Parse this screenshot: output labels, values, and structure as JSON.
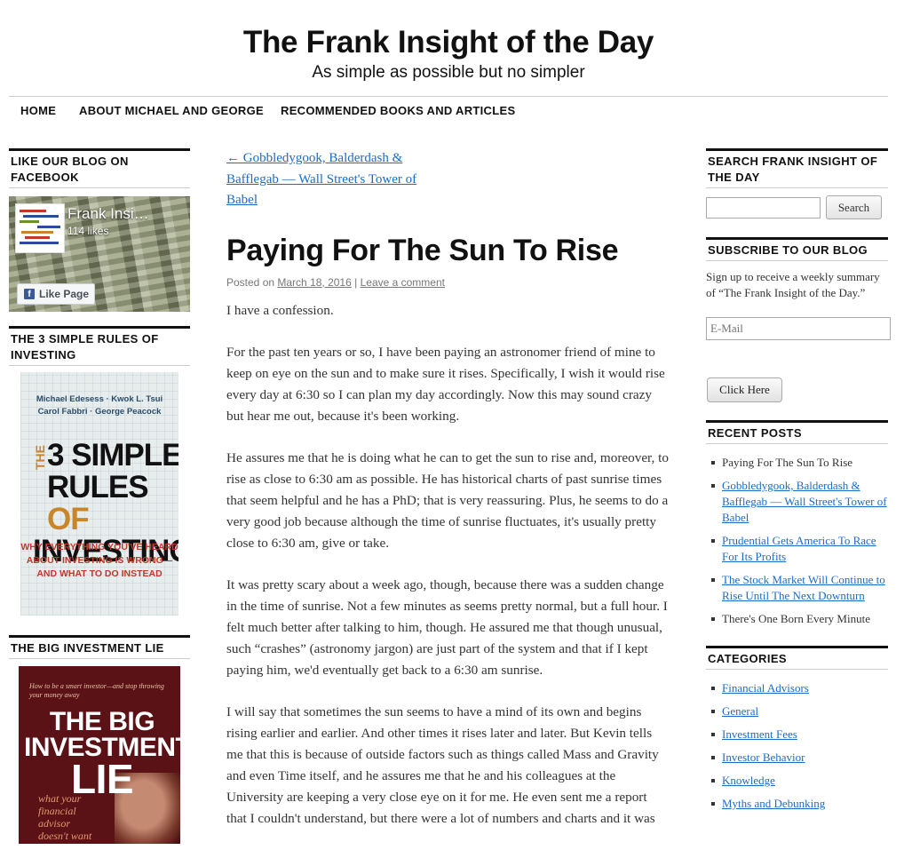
{
  "header": {
    "site_title": "The Frank Insight of the Day",
    "site_description": "As simple as possible but no simpler"
  },
  "nav": {
    "items": [
      "HOME",
      "ABOUT MICHAEL AND GEORGE",
      "RECOMMENDED BOOKS AND ARTICLES"
    ]
  },
  "left_sidebar": {
    "facebook": {
      "title": "LIKE OUR BLOG ON FACEBOOK",
      "page_name": "Frank Insi…",
      "likes": "114 likes",
      "like_button": "Like Page"
    },
    "book1": {
      "title": "THE 3 SIMPLE RULES OF INVESTING",
      "authors_line1": "Michael Edesess · Kwok L. Tsui",
      "authors_line2": "Carol Fabbri · George Peacock",
      "cover_the": "THE",
      "cover_line1": "3 SIMPLE",
      "cover_line2a": "RULES ",
      "cover_line2b": "OF",
      "cover_line3": "INVESTING",
      "cover_sub": "WHY EVERYTHING YOU'VE HEARD ABOUT INVESTING IS WRONG—AND WHAT TO DO INSTEAD"
    },
    "book2": {
      "title": "THE BIG INVESTMENT LIE",
      "cover_tagline": "How to be a smart investor—and stop throwing your money away",
      "cover_line1": "THE BIG",
      "cover_line2": "INVESTMENT",
      "cover_line3": "LIE",
      "cover_sub": "what your financial advisor doesn't want you"
    }
  },
  "post": {
    "prev_link": "← Gobbledygook, Balderdash & Bafflegab — Wall Street's Tower of Babel",
    "title": "Paying For The Sun To Rise",
    "meta_prefix": "Posted on",
    "date": "March 18, 2016",
    "separator": "|",
    "comment_link": "Leave a comment",
    "paragraphs": [
      "I have a confession.",
      "For the past ten years or so, I have been paying an astronomer friend of mine to keep on eye on the sun and to make sure it rises.  Specifically, I wish it would rise every day at 6:30 so I can plan my day accordingly. Now this may sound crazy but hear me out, because it's been working.",
      "He assures me that he is doing what he can to get the sun to rise and, moreover, to rise as close to 6:30 am as possible.  He has historical charts of past sunrise times that seem helpful and he has a PhD; that is very reassuring.  Plus, he seems to do a very good job because although the time of sunrise fluctuates, it's usually pretty close to 6:30 am, give or take.",
      "It was pretty scary about a week ago, though, because there was a sudden change in the time of sunrise.  Not a few minutes as seems pretty normal, but a full hour.  I felt much better after talking to him, though.  He assured me that though unusual, such “crashes” (astronomy jargon) are just part of the system and that if I kept paying him, we'd eventually get back to a 6:30 am sunrise.",
      "I will say that sometimes the sun seems to have a mind of its own and begins rising earlier and earlier.  And other times it rises later and later.  But Kevin tells me that this is because of outside factors such as things called Mass and Gravity and even Time itself, and he assures me that he and his colleagues at the University are keeping a very close eye on it for me.  He even sent me a report that I couldn't understand, but there were a lot of numbers and charts and it was"
    ]
  },
  "right_sidebar": {
    "search": {
      "title": "SEARCH FRANK INSIGHT OF THE DAY",
      "input_value": "",
      "button": "Search"
    },
    "subscribe": {
      "title": "SUBSCRIBE TO OUR BLOG",
      "text": "Sign up to receive a weekly summary of “The Frank Insight of the Day.”",
      "email_placeholder": "E-Mail",
      "button": "Click Here"
    },
    "recent_posts": {
      "title": "RECENT POSTS",
      "items": [
        "Paying For The Sun To Rise",
        "Gobbledygook, Balderdash & Bafflegab — Wall Street's Tower of Babel",
        "Prudential Gets America To Race For Its Profits",
        "The Stock Market Will Continue to Rise Until The Next Downturn",
        "There's One Born Every Minute"
      ]
    },
    "categories": {
      "title": "CATEGORIES",
      "items": [
        "Financial Advisors",
        "General",
        "Investment Fees",
        "Investor Behavior",
        "Knowledge",
        "Myths and Debunking"
      ]
    }
  },
  "colors": {
    "link": "#1b6cc8",
    "text": "#333333",
    "heading": "#111111",
    "rule": "#111111"
  }
}
